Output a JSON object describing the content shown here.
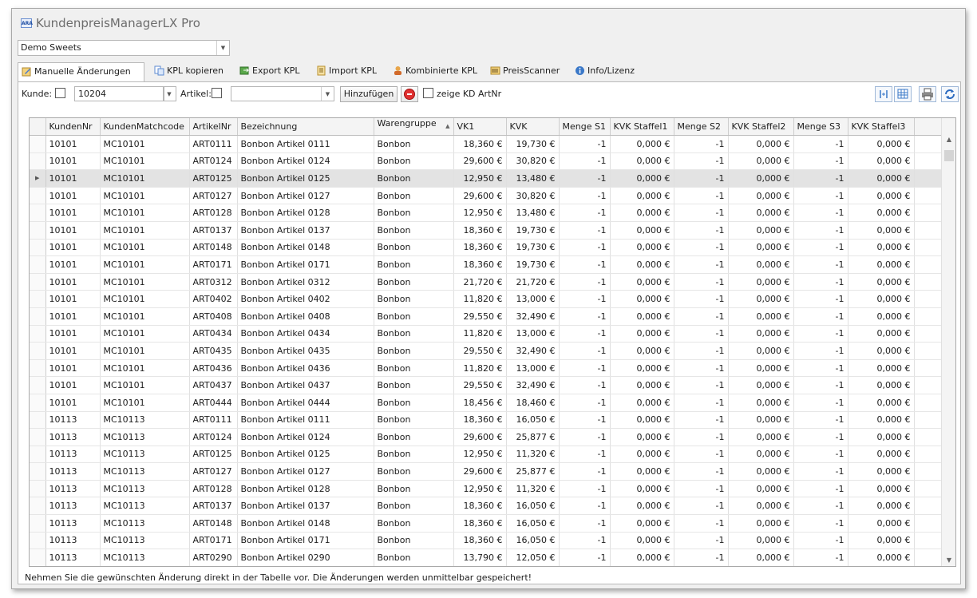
{
  "app": {
    "title": "KundenpreisManagerLX Pro",
    "logo_text": "ARA"
  },
  "shop": {
    "selected": "Demo Sweets"
  },
  "tabs": [
    {
      "label": "Manuelle Änderungen"
    },
    {
      "label": "KPL kopieren"
    },
    {
      "label": "Export KPL"
    },
    {
      "label": "Import KPL"
    },
    {
      "label": "Kombinierte KPL"
    },
    {
      "label": "PreisScanner"
    },
    {
      "label": "Info/Lizenz"
    }
  ],
  "toolbar": {
    "kunde_label": "Kunde:",
    "kunde_value": "10204",
    "artikel_label": "Artikel:",
    "artikel_value": "",
    "add_label": "Hinzufügen",
    "show_artnr_label": "zeige KD ArtNr"
  },
  "grid": {
    "columns": [
      "KundenNr",
      "KundenMatchcode",
      "ArtikelNr",
      "Bezeichnung",
      "Warengruppe",
      "VK1",
      "KVK",
      "Menge S1",
      "KVK Staffel1",
      "Menge S2",
      "KVK Staffel2",
      "Menge S3",
      "KVK Staffel3"
    ],
    "sort_indicator": "▲",
    "selected_row": 2,
    "rows": [
      [
        "10101",
        "MC10101",
        "ART0111",
        "Bonbon Artikel 0111",
        "Bonbon",
        "18,360 €",
        "19,730 €",
        "-1",
        "0,000 €",
        "-1",
        "0,000 €",
        "-1",
        "0,000 €"
      ],
      [
        "10101",
        "MC10101",
        "ART0124",
        "Bonbon Artikel 0124",
        "Bonbon",
        "29,600 €",
        "30,820 €",
        "-1",
        "0,000 €",
        "-1",
        "0,000 €",
        "-1",
        "0,000 €"
      ],
      [
        "10101",
        "MC10101",
        "ART0125",
        "Bonbon Artikel 0125",
        "Bonbon",
        "12,950 €",
        "13,480 €",
        "-1",
        "0,000 €",
        "-1",
        "0,000 €",
        "-1",
        "0,000 €"
      ],
      [
        "10101",
        "MC10101",
        "ART0127",
        "Bonbon Artikel 0127",
        "Bonbon",
        "29,600 €",
        "30,820 €",
        "-1",
        "0,000 €",
        "-1",
        "0,000 €",
        "-1",
        "0,000 €"
      ],
      [
        "10101",
        "MC10101",
        "ART0128",
        "Bonbon Artikel 0128",
        "Bonbon",
        "12,950 €",
        "13,480 €",
        "-1",
        "0,000 €",
        "-1",
        "0,000 €",
        "-1",
        "0,000 €"
      ],
      [
        "10101",
        "MC10101",
        "ART0137",
        "Bonbon Artikel 0137",
        "Bonbon",
        "18,360 €",
        "19,730 €",
        "-1",
        "0,000 €",
        "-1",
        "0,000 €",
        "-1",
        "0,000 €"
      ],
      [
        "10101",
        "MC10101",
        "ART0148",
        "Bonbon Artikel 0148",
        "Bonbon",
        "18,360 €",
        "19,730 €",
        "-1",
        "0,000 €",
        "-1",
        "0,000 €",
        "-1",
        "0,000 €"
      ],
      [
        "10101",
        "MC10101",
        "ART0171",
        "Bonbon Artikel 0171",
        "Bonbon",
        "18,360 €",
        "19,730 €",
        "-1",
        "0,000 €",
        "-1",
        "0,000 €",
        "-1",
        "0,000 €"
      ],
      [
        "10101",
        "MC10101",
        "ART0312",
        "Bonbon Artikel 0312",
        "Bonbon",
        "21,720 €",
        "21,720 €",
        "-1",
        "0,000 €",
        "-1",
        "0,000 €",
        "-1",
        "0,000 €"
      ],
      [
        "10101",
        "MC10101",
        "ART0402",
        "Bonbon Artikel 0402",
        "Bonbon",
        "11,820 €",
        "13,000 €",
        "-1",
        "0,000 €",
        "-1",
        "0,000 €",
        "-1",
        "0,000 €"
      ],
      [
        "10101",
        "MC10101",
        "ART0408",
        "Bonbon Artikel 0408",
        "Bonbon",
        "29,550 €",
        "32,490 €",
        "-1",
        "0,000 €",
        "-1",
        "0,000 €",
        "-1",
        "0,000 €"
      ],
      [
        "10101",
        "MC10101",
        "ART0434",
        "Bonbon Artikel 0434",
        "Bonbon",
        "11,820 €",
        "13,000 €",
        "-1",
        "0,000 €",
        "-1",
        "0,000 €",
        "-1",
        "0,000 €"
      ],
      [
        "10101",
        "MC10101",
        "ART0435",
        "Bonbon Artikel 0435",
        "Bonbon",
        "29,550 €",
        "32,490 €",
        "-1",
        "0,000 €",
        "-1",
        "0,000 €",
        "-1",
        "0,000 €"
      ],
      [
        "10101",
        "MC10101",
        "ART0436",
        "Bonbon Artikel 0436",
        "Bonbon",
        "11,820 €",
        "13,000 €",
        "-1",
        "0,000 €",
        "-1",
        "0,000 €",
        "-1",
        "0,000 €"
      ],
      [
        "10101",
        "MC10101",
        "ART0437",
        "Bonbon Artikel 0437",
        "Bonbon",
        "29,550 €",
        "32,490 €",
        "-1",
        "0,000 €",
        "-1",
        "0,000 €",
        "-1",
        "0,000 €"
      ],
      [
        "10101",
        "MC10101",
        "ART0444",
        "Bonbon Artikel 0444",
        "Bonbon",
        "18,456 €",
        "18,460 €",
        "-1",
        "0,000 €",
        "-1",
        "0,000 €",
        "-1",
        "0,000 €"
      ],
      [
        "10113",
        "MC10113",
        "ART0111",
        "Bonbon Artikel 0111",
        "Bonbon",
        "18,360 €",
        "16,050 €",
        "-1",
        "0,000 €",
        "-1",
        "0,000 €",
        "-1",
        "0,000 €"
      ],
      [
        "10113",
        "MC10113",
        "ART0124",
        "Bonbon Artikel 0124",
        "Bonbon",
        "29,600 €",
        "25,877 €",
        "-1",
        "0,000 €",
        "-1",
        "0,000 €",
        "-1",
        "0,000 €"
      ],
      [
        "10113",
        "MC10113",
        "ART0125",
        "Bonbon Artikel 0125",
        "Bonbon",
        "12,950 €",
        "11,320 €",
        "-1",
        "0,000 €",
        "-1",
        "0,000 €",
        "-1",
        "0,000 €"
      ],
      [
        "10113",
        "MC10113",
        "ART0127",
        "Bonbon Artikel 0127",
        "Bonbon",
        "29,600 €",
        "25,877 €",
        "-1",
        "0,000 €",
        "-1",
        "0,000 €",
        "-1",
        "0,000 €"
      ],
      [
        "10113",
        "MC10113",
        "ART0128",
        "Bonbon Artikel 0128",
        "Bonbon",
        "12,950 €",
        "11,320 €",
        "-1",
        "0,000 €",
        "-1",
        "0,000 €",
        "-1",
        "0,000 €"
      ],
      [
        "10113",
        "MC10113",
        "ART0137",
        "Bonbon Artikel 0137",
        "Bonbon",
        "18,360 €",
        "16,050 €",
        "-1",
        "0,000 €",
        "-1",
        "0,000 €",
        "-1",
        "0,000 €"
      ],
      [
        "10113",
        "MC10113",
        "ART0148",
        "Bonbon Artikel 0148",
        "Bonbon",
        "18,360 €",
        "16,050 €",
        "-1",
        "0,000 €",
        "-1",
        "0,000 €",
        "-1",
        "0,000 €"
      ],
      [
        "10113",
        "MC10113",
        "ART0171",
        "Bonbon Artikel 0171",
        "Bonbon",
        "18,360 €",
        "16,050 €",
        "-1",
        "0,000 €",
        "-1",
        "0,000 €",
        "-1",
        "0,000 €"
      ],
      [
        "10113",
        "MC10113",
        "ART0290",
        "Bonbon Artikel 0290",
        "Bonbon",
        "13,790 €",
        "12,050 €",
        "-1",
        "0,000 €",
        "-1",
        "0,000 €",
        "-1",
        "0,000 €"
      ]
    ]
  },
  "status": {
    "message": "Nehmen Sie die gewünschten Änderung direkt in der Tabelle vor. Die Änderungen werden unmittelbar gespeichert!"
  },
  "colors": {
    "accent": "#3a78c8",
    "selected_row": "#e3e3e3",
    "delete": "#e03030"
  }
}
